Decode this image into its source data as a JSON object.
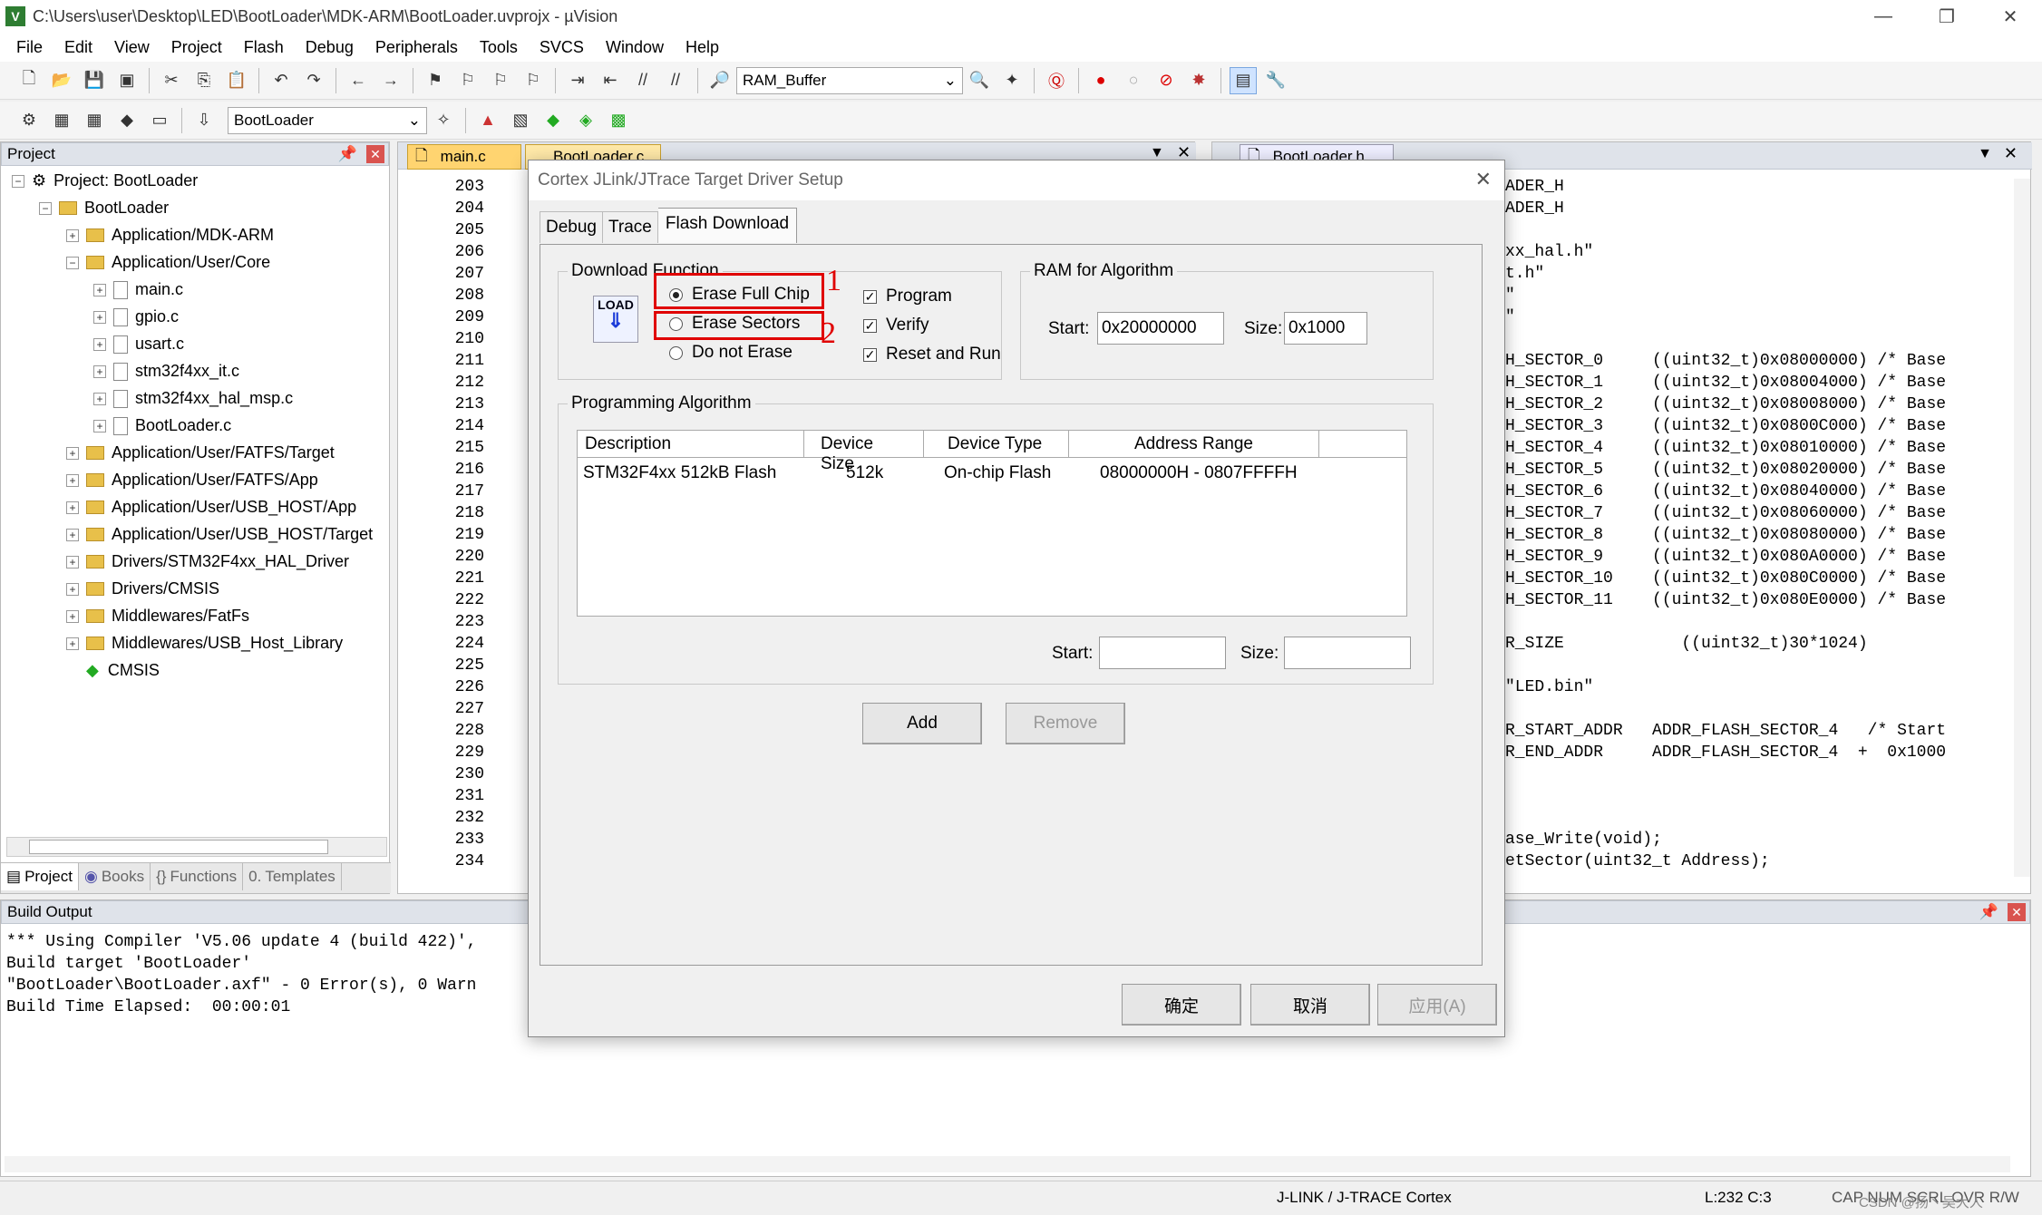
{
  "window": {
    "title": "C:\\Users\\user\\Desktop\\LED\\BootLoader\\MDK-ARM\\BootLoader.uvprojx - µVision"
  },
  "menu": [
    "File",
    "Edit",
    "View",
    "Project",
    "Flash",
    "Debug",
    "Peripherals",
    "Tools",
    "SVCS",
    "Window",
    "Help"
  ],
  "toolbar1": {
    "combo": "RAM_Buffer"
  },
  "toolbar2": {
    "target_combo": "BootLoader"
  },
  "project_panel": {
    "title": "Project",
    "root": "Project: BootLoader",
    "target": "BootLoader",
    "items": [
      "Application/MDK-ARM",
      "Application/User/Core",
      "main.c",
      "gpio.c",
      "usart.c",
      "stm32f4xx_it.c",
      "stm32f4xx_hal_msp.c",
      "BootLoader.c",
      "Application/User/FATFS/Target",
      "Application/User/FATFS/App",
      "Application/User/USB_HOST/App",
      "Application/User/USB_HOST/Target",
      "Drivers/STM32F4xx_HAL_Driver",
      "Drivers/CMSIS",
      "Middlewares/FatFs",
      "Middlewares/USB_Host_Library",
      "CMSIS"
    ],
    "tabs": [
      "Project",
      "Books",
      "Functions",
      "Templates"
    ]
  },
  "editor": {
    "tab_left_active": "main.c",
    "tab_left_2": "BootLoader.c",
    "tab_right": "BootLoader.h",
    "line_numbers": [
      "203",
      "204",
      "205",
      "206",
      "207",
      "208",
      "209",
      "210",
      "211",
      "212",
      "213",
      "214",
      "215",
      "216",
      "217",
      "218",
      "219",
      "220",
      "221",
      "222",
      "223",
      "224",
      "225",
      "226",
      "227",
      "228",
      "229",
      "230",
      "231",
      "232",
      "233",
      "234"
    ],
    "right_lines": [
      "ADER_H",
      "ADER_H",
      "",
      "xx_hal.h\"",
      "t.h\"",
      "\"",
      "\"",
      "",
      "H_SECTOR_0     ((uint32_t)0x08000000) /* Base",
      "H_SECTOR_1     ((uint32_t)0x08004000) /* Base",
      "H_SECTOR_2     ((uint32_t)0x08008000) /* Base",
      "H_SECTOR_3     ((uint32_t)0x0800C000) /* Base",
      "H_SECTOR_4     ((uint32_t)0x08010000) /* Base",
      "H_SECTOR_5     ((uint32_t)0x08020000) /* Base",
      "H_SECTOR_6     ((uint32_t)0x08040000) /* Base",
      "H_SECTOR_7     ((uint32_t)0x08060000) /* Base",
      "H_SECTOR_8     ((uint32_t)0x08080000) /* Base",
      "H_SECTOR_9     ((uint32_t)0x080A0000) /* Base",
      "H_SECTOR_10    ((uint32_t)0x080C0000) /* Base",
      "H_SECTOR_11    ((uint32_t)0x080E0000) /* Base",
      "",
      "R_SIZE            ((uint32_t)30*1024)",
      "",
      "\"LED.bin\"",
      "",
      "R_START_ADDR   ADDR_FLASH_SECTOR_4   /* Start",
      "R_END_ADDR     ADDR_FLASH_SECTOR_4  +  0x1000",
      "",
      "",
      "",
      "ase_Write(void);",
      "etSector(uint32_t Address);"
    ]
  },
  "build_output": {
    "title": "Build Output",
    "lines": [
      "*** Using Compiler 'V5.06 update 4 (build 422)',",
      "Build target 'BootLoader'",
      "\"BootLoader\\BootLoader.axf\" - 0 Error(s), 0 Warn",
      "Build Time Elapsed:  00:00:01"
    ]
  },
  "dialog": {
    "title": "Cortex JLink/JTrace Target Driver Setup",
    "tabs": [
      "Debug",
      "Trace",
      "Flash Download"
    ],
    "download_function": {
      "title": "Download Function",
      "logo": "LOAD",
      "radios": [
        "Erase Full Chip",
        "Erase Sectors",
        "Do not Erase"
      ],
      "selected": "Erase Full Chip",
      "checks": [
        "Program",
        "Verify",
        "Reset and Run"
      ]
    },
    "ram": {
      "title": "RAM for Algorithm",
      "start_label": "Start:",
      "start_value": "0x20000000",
      "size_label": "Size:",
      "size_value": "0x1000"
    },
    "programming": {
      "title": "Programming Algorithm",
      "columns": [
        "Description",
        "Device Size",
        "Device Type",
        "Address Range"
      ],
      "rows": [
        [
          "STM32F4xx 512kB Flash",
          "512k",
          "On-chip Flash",
          "08000000H - 0807FFFFH"
        ]
      ],
      "start_label": "Start:",
      "size_label": "Size:"
    },
    "buttons": {
      "add": "Add",
      "remove": "Remove",
      "ok": "确定",
      "cancel": "取消",
      "apply": "应用(A)"
    },
    "annotations": [
      "1",
      "2"
    ]
  },
  "statusbar": {
    "debugger": "J-LINK / J-TRACE Cortex",
    "position": "L:232 C:3",
    "flags": "CAP NUM SCRL OVR R/W",
    "watermark": "CSDN @扬丶吴大人"
  }
}
